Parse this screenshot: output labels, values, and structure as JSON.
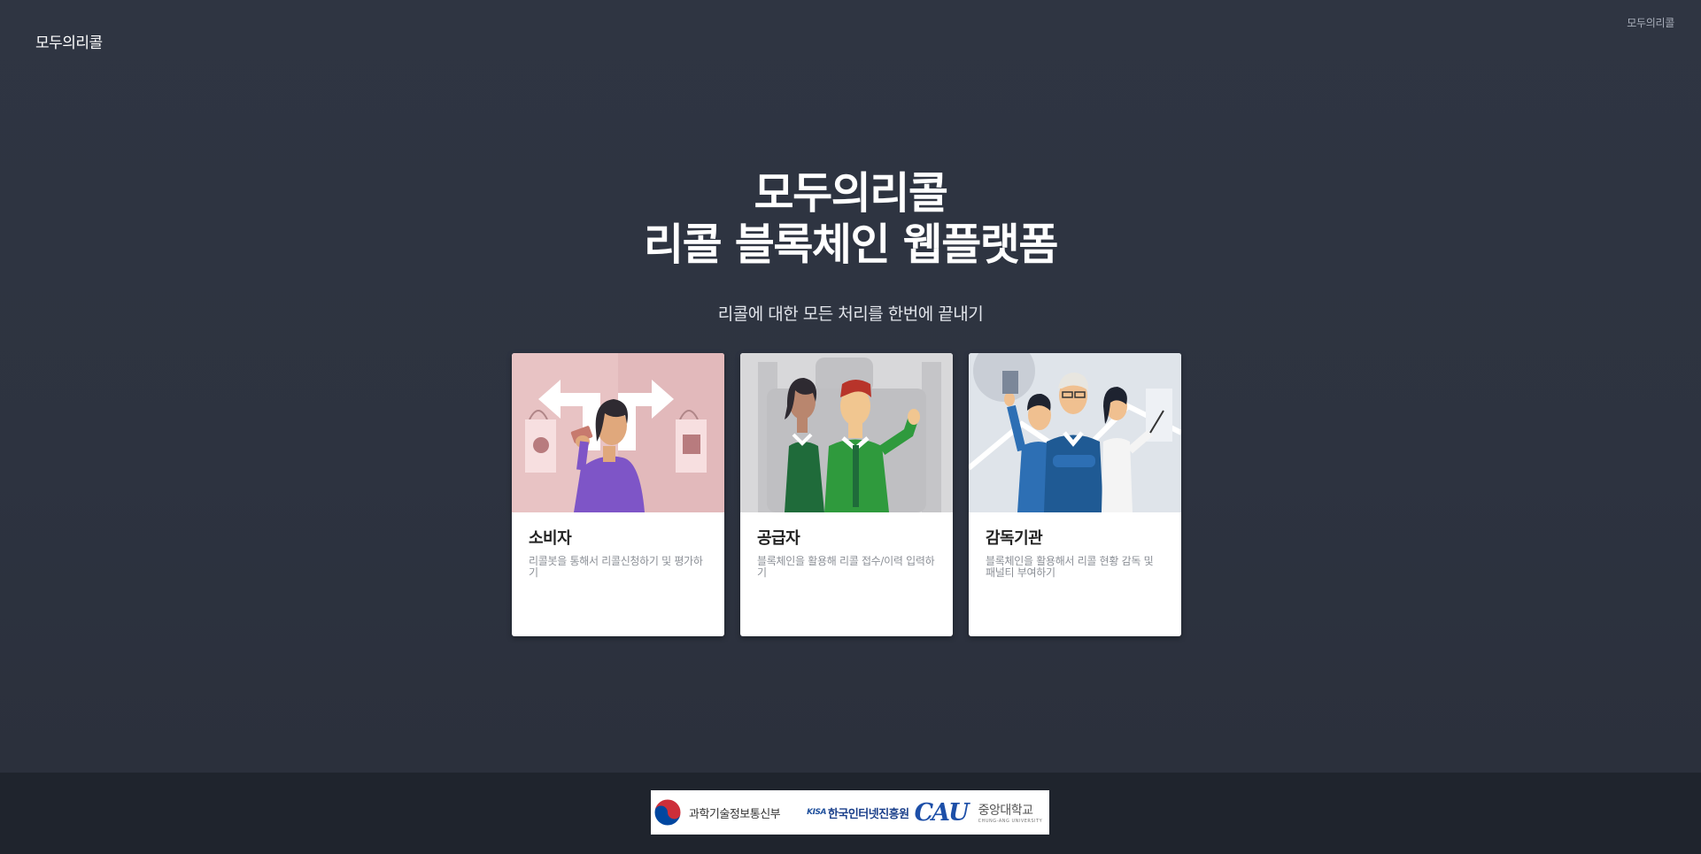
{
  "header": {
    "brand": "모두의리콜",
    "top_link": "모두의리콜"
  },
  "hero": {
    "title_line1": "모두의리콜",
    "title_line2": "리콜 블록체인 웹플랫폼",
    "subtitle": "리콜에 대한 모든 처리를 한번에 끝내기"
  },
  "cards": [
    {
      "title": "소비자",
      "description": "리콜봇을 통해서 리콜신청하기 및 평가하기"
    },
    {
      "title": "공급자",
      "description": "블록체인을 활용해 리콜 접수/이력 입력하기"
    },
    {
      "title": "감독기관",
      "description": "블록체인을 활용해서 리콜 현황 감독 및 패널티 부여하기"
    }
  ],
  "footer": {
    "logos": [
      {
        "name": "과학기술정보통신부",
        "icon": "taegeuk-emblem-icon"
      },
      {
        "name": "한국인터넷진흥원",
        "prefix": "KISA",
        "icon": "kisa-logo-icon"
      },
      {
        "name": "중앙대학교",
        "mark": "CAU",
        "english": "CHUNG-ANG UNIVERSITY",
        "icon": "cau-logo-icon"
      }
    ]
  },
  "colors": {
    "background": "#2d3340",
    "footer": "#1f242d",
    "consumer_card_bg": "#e8c3c4",
    "supplier_card_bg": "#d8d8da",
    "regulator_card_bg": "#dfe4ea"
  }
}
